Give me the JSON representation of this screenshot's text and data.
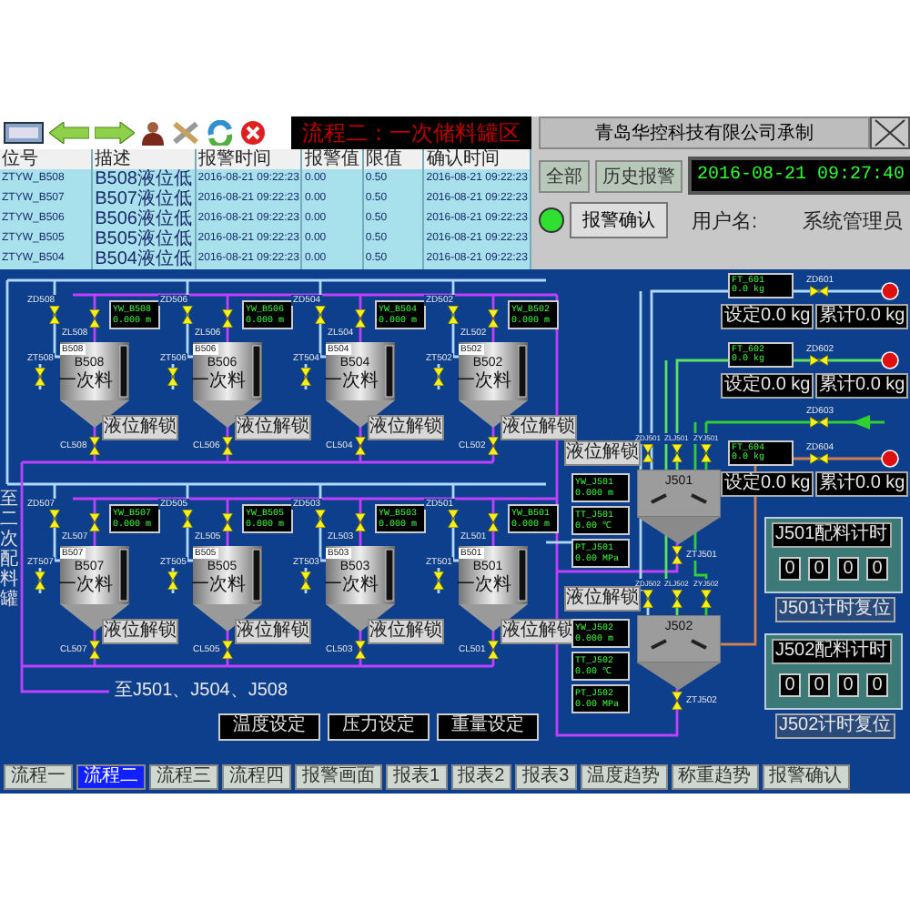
{
  "title": "流程二：一次储料罐区",
  "company": "青岛华控科技有限公司承制",
  "alarm_table": {
    "columns": [
      {
        "label": "位号",
        "kind": "tag"
      },
      {
        "label": "描述",
        "kind": "desc"
      },
      {
        "label": "报警时间",
        "kind": "time"
      },
      {
        "label": "报警值",
        "kind": "value"
      },
      {
        "label": "限值",
        "kind": "value"
      },
      {
        "label": "确认时间",
        "kind": "time"
      }
    ],
    "rows": [
      [
        "ZTYW_B508",
        "B508液位低",
        "2016-08-21 09:22:23",
        "0.00",
        "0.50",
        "2016-08-21 09:22:23"
      ],
      [
        "ZTYW_B507",
        "B507液位低",
        "2016-08-21 09:22:23",
        "0.00",
        "0.50",
        "2016-08-21 09:22:23"
      ],
      [
        "ZTYW_B506",
        "B506液位低",
        "2016-08-21 09:22:23",
        "0.00",
        "0.50",
        "2016-08-21 09:22:23"
      ],
      [
        "ZTYW_B505",
        "B505液位低",
        "2016-08-21 09:22:23",
        "0.00",
        "0.50",
        "2016-08-21 09:22:23"
      ],
      [
        "ZTYW_B504",
        "B504液位低",
        "2016-08-21 09:22:23",
        "0.00",
        "0.50",
        "2016-08-21 09:22:23"
      ]
    ]
  },
  "alarm_buttons": [
    "全部",
    "历史报警"
  ],
  "clock": "2016-08-21 09:27:40",
  "alarm_lamp": {
    "on": true
  },
  "ack_button": "报警确认",
  "user_label": "用户名:",
  "user_name": "系统管理员",
  "pipe_label": "至二次配料罐",
  "tank_rows": [
    [
      {
        "tag": "B508",
        "desc": "一次料",
        "corner": "B508",
        "readout": [
          "YW_B508",
          "0.000 m"
        ],
        "valves": {
          "inlet": "ZD508",
          "top": "ZL508",
          "side": "ZT508",
          "outlet": "CL508"
        },
        "unlock": "液位解锁"
      },
      {
        "tag": "B506",
        "desc": "一次料",
        "corner": "B506",
        "readout": [
          "YW_B506",
          "0.000 m"
        ],
        "valves": {
          "inlet": "ZD506",
          "top": "ZL506",
          "side": "ZT506",
          "outlet": "CL506"
        },
        "unlock": "液位解锁"
      },
      {
        "tag": "B504",
        "desc": "一次料",
        "corner": "B504",
        "readout": [
          "YW_B504",
          "0.000 m"
        ],
        "valves": {
          "inlet": "ZD504",
          "top": "ZL504",
          "side": "ZT504",
          "outlet": "CL504"
        },
        "unlock": "液位解锁"
      },
      {
        "tag": "B502",
        "desc": "一次料",
        "corner": "B502",
        "readout": [
          "YW_B502",
          "0.000 m"
        ],
        "valves": {
          "inlet": "ZD502",
          "top": "ZL502",
          "side": "ZT502",
          "outlet": "CL502"
        },
        "unlock": "液位解锁"
      }
    ],
    [
      {
        "tag": "B507",
        "desc": "一次料",
        "corner": "B507",
        "readout": [
          "YW_B507",
          "0.000 m"
        ],
        "valves": {
          "inlet": "ZD507",
          "top": "ZL507",
          "side": "ZT507",
          "outlet": "CL507"
        },
        "unlock": "液位解锁"
      },
      {
        "tag": "B505",
        "desc": "一次料",
        "corner": "B505",
        "readout": [
          "YW_B505",
          "0.000 m"
        ],
        "valves": {
          "inlet": "ZD505",
          "top": "ZL505",
          "side": "ZT505",
          "outlet": "CL505"
        },
        "unlock": "液位解锁"
      },
      {
        "tag": "B503",
        "desc": "一次料",
        "corner": "B503",
        "readout": [
          "YW_B503",
          "0.000 m"
        ],
        "valves": {
          "inlet": "ZD503",
          "top": "ZL503",
          "side": "ZT503",
          "outlet": "CL503"
        },
        "unlock": "液位解锁"
      },
      {
        "tag": "B501",
        "desc": "一次料",
        "corner": "B501",
        "readout": [
          "YW_B501",
          "0.000 m"
        ],
        "valves": {
          "inlet": "ZD501",
          "top": "ZL501",
          "side": "ZT501",
          "outlet": "CL501"
        },
        "unlock": "液位解锁"
      }
    ]
  ],
  "return_label": "至J501、J504、J508",
  "setpoint_boxes": [
    "温度设定",
    "压力设定",
    "重量设定"
  ],
  "reactors": [
    {
      "tag": "J501",
      "readouts": [
        [
          "YW_J501",
          "0.000 m"
        ],
        [
          "TT_J501",
          "0.00 ℃"
        ],
        [
          "PT_J501",
          "0.00 MPa"
        ]
      ],
      "inlets": [
        "ZDJ501",
        "ZLJ501",
        "ZYJ501"
      ],
      "outlet": "ZTJ501",
      "unlock": "液位解锁"
    },
    {
      "tag": "J502",
      "readouts": [
        [
          "YW_J502",
          "0.000 m"
        ],
        [
          "TT_J502",
          "0.00 ℃"
        ],
        [
          "PT_J502",
          "0.00 MPa"
        ]
      ],
      "inlets": [
        "ZDJ502",
        "ZLJ502",
        "ZYJ502"
      ],
      "outlet": "ZTJ502",
      "unlock": "液位解锁"
    }
  ],
  "feeds": [
    {
      "kind": "metered",
      "color": "#b0d8ff",
      "valve": "ZD601",
      "readout": [
        "FT_601",
        "0.0 kg"
      ],
      "set": "设定0.0 kg",
      "total": "累计0.0 kg"
    },
    {
      "kind": "metered",
      "color": "#60e060",
      "valve": "ZD602",
      "readout": [
        "FT_602",
        "0.0 kg"
      ],
      "set": "设定0.0 kg",
      "total": "累计0.0 kg"
    },
    {
      "kind": "plain",
      "color": "#30d030",
      "valve": "ZD603"
    },
    {
      "kind": "metered",
      "color": "#d08050",
      "valve": "ZD604",
      "readout": [
        "FT_604",
        "0.0 kg"
      ],
      "set": "设定0.0 kg",
      "total": "累计0.0 kg"
    }
  ],
  "timers": [
    {
      "title": "J501配料计时",
      "digits": [
        "0",
        "0",
        "0",
        "0"
      ],
      "caption": "J501计时复位"
    },
    {
      "title": "J502配料计时",
      "digits": [
        "0",
        "0",
        "0",
        "0"
      ],
      "caption": "J502计时复位"
    }
  ],
  "nav": [
    {
      "label": "流程一",
      "selected": false
    },
    {
      "label": "流程二",
      "selected": true
    },
    {
      "label": "流程三",
      "selected": false
    },
    {
      "label": "流程四",
      "selected": false
    },
    {
      "label": "报警画面",
      "selected": false
    },
    {
      "label": "报表1",
      "selected": false
    },
    {
      "label": "报表2",
      "selected": false
    },
    {
      "label": "报表3",
      "selected": false
    },
    {
      "label": "温度趋势",
      "selected": false
    },
    {
      "label": "称重趋势",
      "selected": false
    }
  ],
  "nav_ack": "报警确认"
}
